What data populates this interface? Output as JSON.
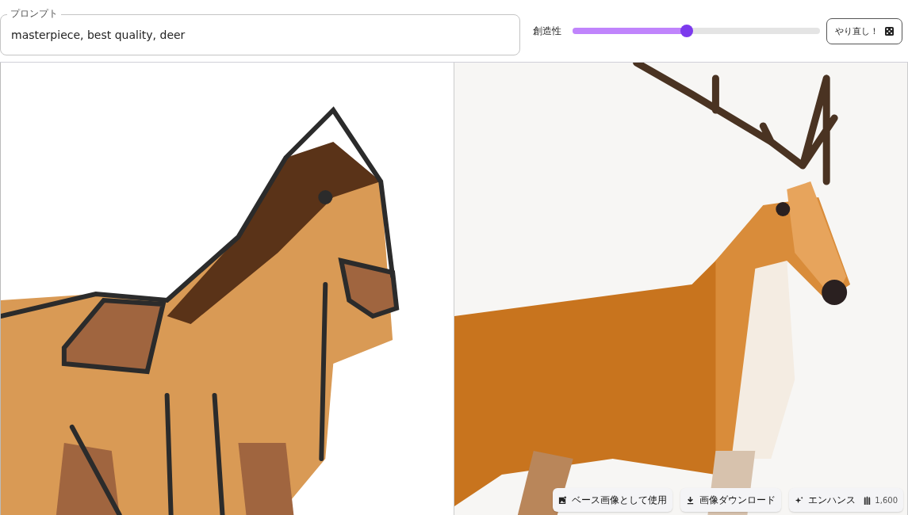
{
  "prompt": {
    "label": "プロンプト",
    "value": "masterpiece, best quality, deer"
  },
  "creativity": {
    "label": "創造性",
    "level": 0.46
  },
  "retry_button": {
    "label": "やり直し！"
  },
  "actions": [
    {
      "kind": "base",
      "label": "ベース画像として使用"
    },
    {
      "kind": "download",
      "label": "画像ダウンロード"
    },
    {
      "kind": "enhance",
      "label": "エンハンス",
      "cost": "1,600"
    }
  ]
}
